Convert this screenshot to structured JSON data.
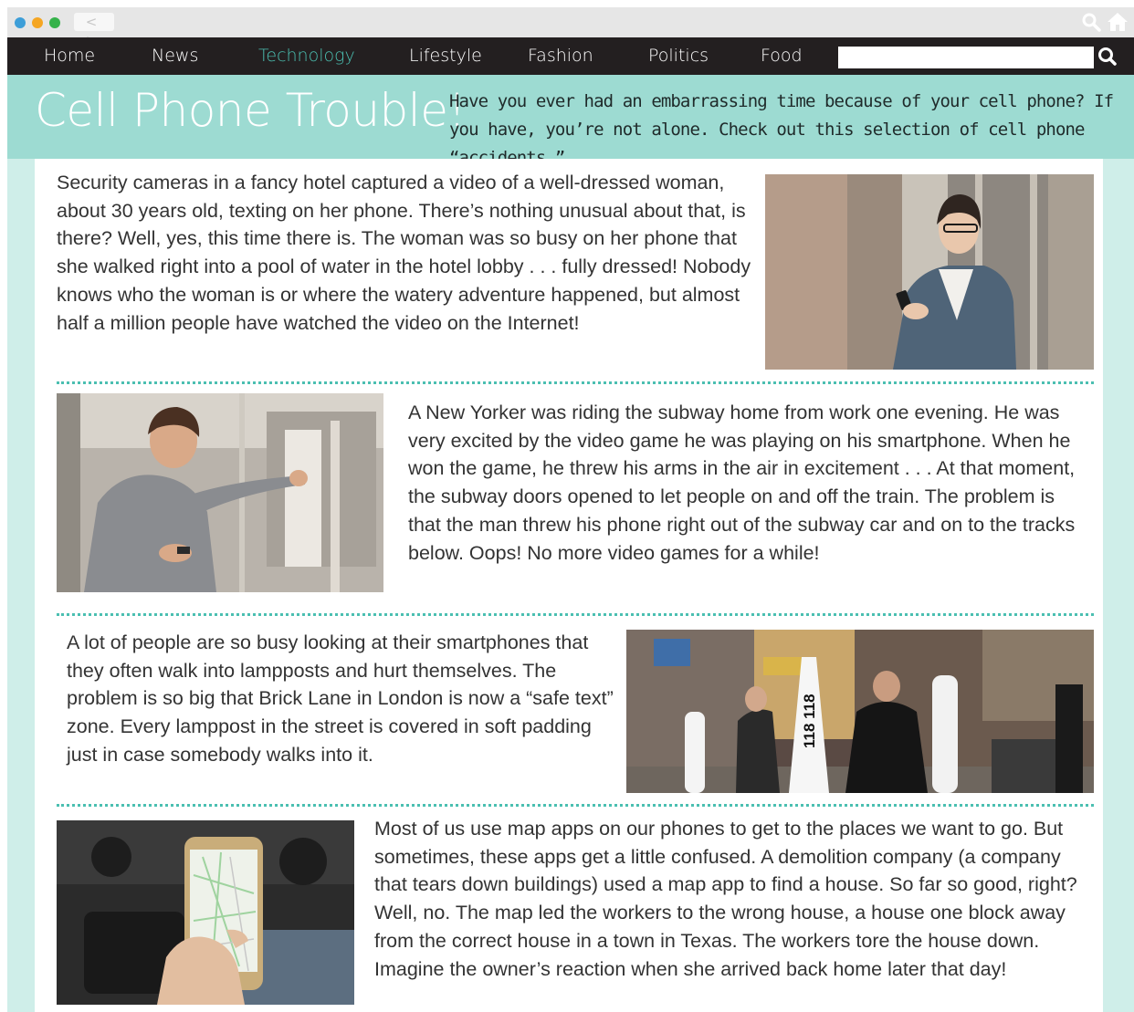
{
  "window": {
    "nav_arrows": "< >"
  },
  "nav": {
    "items": [
      {
        "label": "Home",
        "active": false
      },
      {
        "label": "News",
        "active": false
      },
      {
        "label": "Technology",
        "active": true
      },
      {
        "label": "Lifestyle",
        "active": false
      },
      {
        "label": "Fashion",
        "active": false
      },
      {
        "label": "Politics",
        "active": false
      },
      {
        "label": "Food",
        "active": false
      }
    ],
    "search_value": "",
    "search_icon": "search-icon"
  },
  "header": {
    "title": "Cell Phone Trouble!",
    "intro": "Have you ever had an embarrassing time because of your cell phone? If you have, you’re not alone. Check out this selection of cell phone “accidents.”"
  },
  "stories": [
    {
      "text": "Security cameras in a fancy hotel captured a video of a well-dressed woman, about 30 years old, texting on her phone. There’s nothing unusual about that, is there? Well, yes, this time there is. The woman was so busy on her phone that she walked right into a pool of water in the hotel lobby . . . fully dressed! Nobody knows who the woman is or where the watery adventure happened, but almost half a million people have watched the video on the Internet!"
    },
    {
      "text": "A New Yorker was riding the subway home from work one evening. He was very excited by the video game he was playing on his smartphone. When he won the game, he threw his arms in the air in excitement . . . At that moment, the subway doors opened to let people on and off the train. The problem is that the man threw his phone right out of the subway car and on to the tracks below. Oops! No more video games for a while!"
    },
    {
      "text": "A lot of people are so busy looking at their smartphones that they often walk into lampposts and hurt themselves. The problem is so big that Brick Lane in London is now a “safe text” zone. Every lamppost in the street is covered in soft padding just in case somebody walks into it.",
      "sign_text": "118 118"
    },
    {
      "text": "Most of us use map apps on our phones to get to the places we want to go. But sometimes, these apps get a little confused. A demolition company (a company that tears down buildings) used a map app to find a house. So far so good, right? Well, no. The map led the workers to the wrong house, a house one block away from the correct house in a town in Texas. The workers tore the house down. Imagine the owner’s reaction when she arrived back home later that day!"
    }
  ],
  "colors": {
    "nav_bg": "#231f20",
    "accent": "#4bbfb1",
    "header_bg": "#9ddbd2",
    "page_bg": "#cfeee9"
  }
}
